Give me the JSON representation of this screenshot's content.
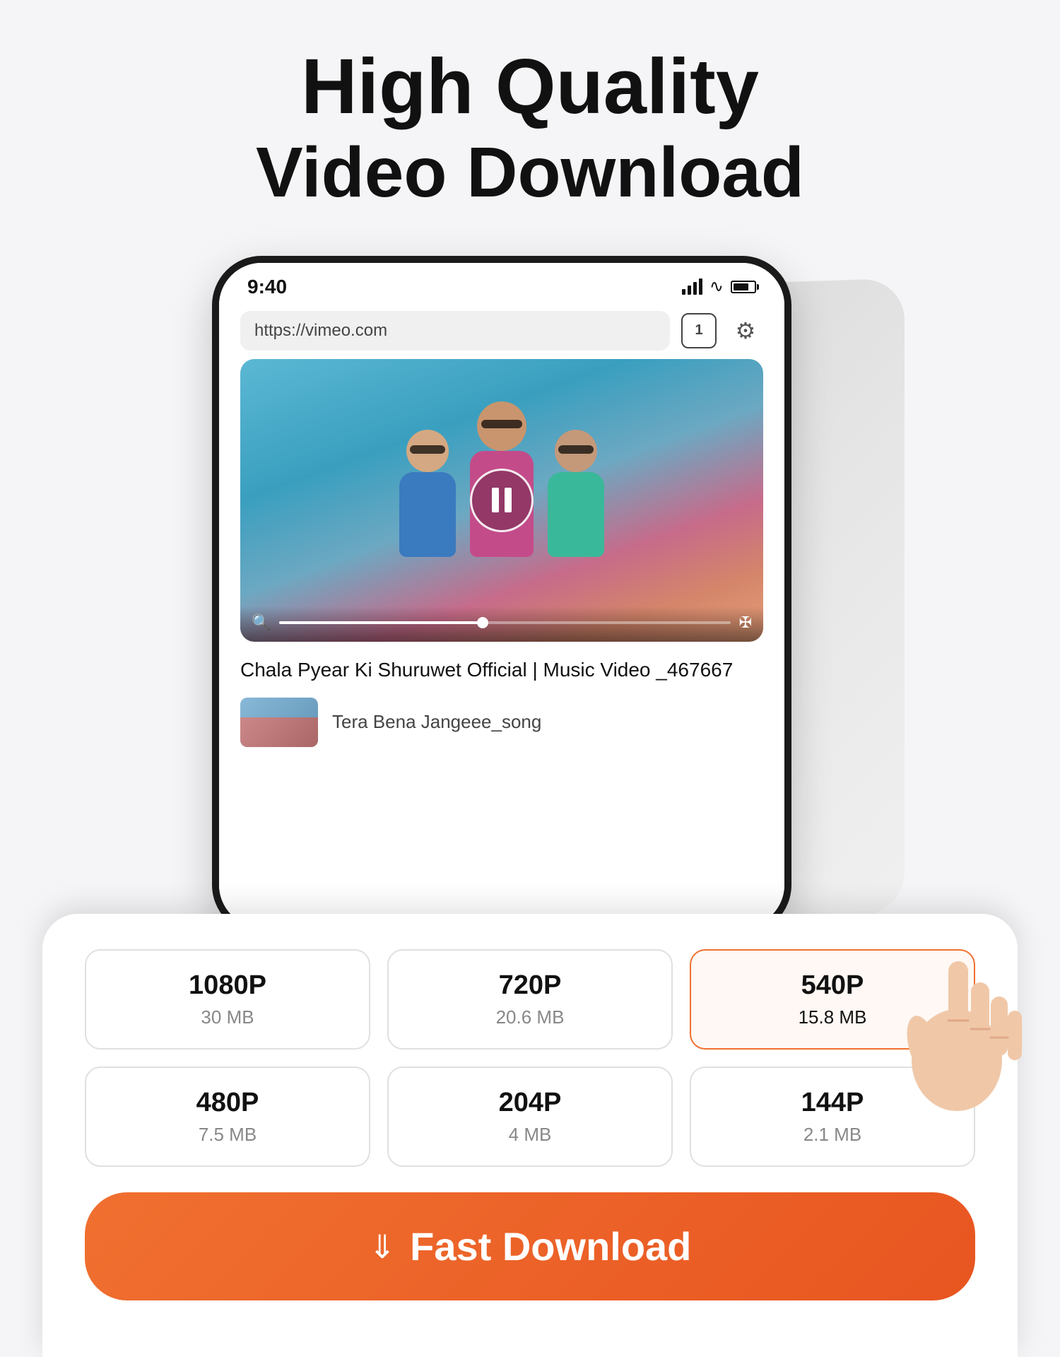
{
  "page": {
    "background": "#f5f5f7",
    "title": {
      "line1": "High Quality",
      "line2": "Video Download"
    }
  },
  "phone": {
    "status": {
      "time": "9:40"
    },
    "url_bar": "https://vimeo.com",
    "tab_count": "1",
    "video": {
      "title": "Chala Pyear Ki Shuruwet Official | Music\nVideo _467667",
      "next_title": "Tera Bena Jangeee_song"
    }
  },
  "download": {
    "qualities": [
      {
        "label": "1080P",
        "size": "30 MB",
        "selected": false
      },
      {
        "label": "720P",
        "size": "20.6 MB",
        "selected": false
      },
      {
        "label": "540P",
        "size": "15.8 MB",
        "selected": true
      },
      {
        "label": "480P",
        "size": "7.5 MB",
        "selected": false
      },
      {
        "label": "204P",
        "size": "4 MB",
        "selected": false
      },
      {
        "label": "144P",
        "size": "2.1 MB",
        "selected": false
      }
    ],
    "button_label": "Fast Download"
  }
}
